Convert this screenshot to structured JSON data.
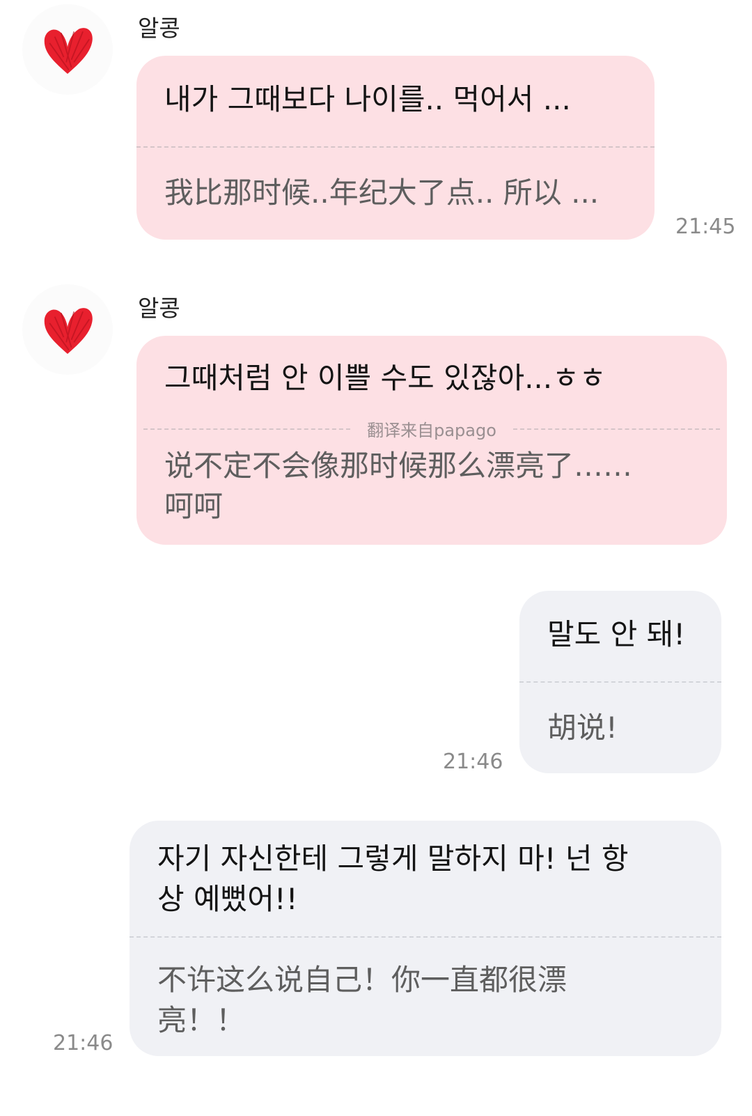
{
  "messages": [
    {
      "sender": "알콩",
      "original": "내가 그때보다 나이를.. 먹어서 ...",
      "translation": "我比那时候..年纪大了点.. 所以 ...",
      "time": "21:45"
    },
    {
      "sender": "알콩",
      "original": "그때처럼 안 이쁠 수도 있잖아...ㅎㅎ",
      "translation_source": "翻译来自papago",
      "translation_line1": "说不定不会像那时候那么漂亮了……",
      "translation_line2": "呵呵"
    },
    {
      "original": "말도 안 돼!",
      "translation": "胡说!",
      "time": "21:46"
    },
    {
      "original_line1": "자기 자신한테 그렇게 말하지 마! 넌 항",
      "original_line2": "상 예뻤어!!",
      "translation_line1": "不许这么说自己！你一直都很漂",
      "translation_line2": "亮！！",
      "time": "21:46"
    }
  ],
  "colors": {
    "incoming_bubble": "#fde0e4",
    "outgoing_bubble": "#f0f1f5",
    "heart": "#e8202e",
    "timestamp": "#8a8a8a"
  },
  "icons": {
    "avatar": "red-heart-icon"
  }
}
